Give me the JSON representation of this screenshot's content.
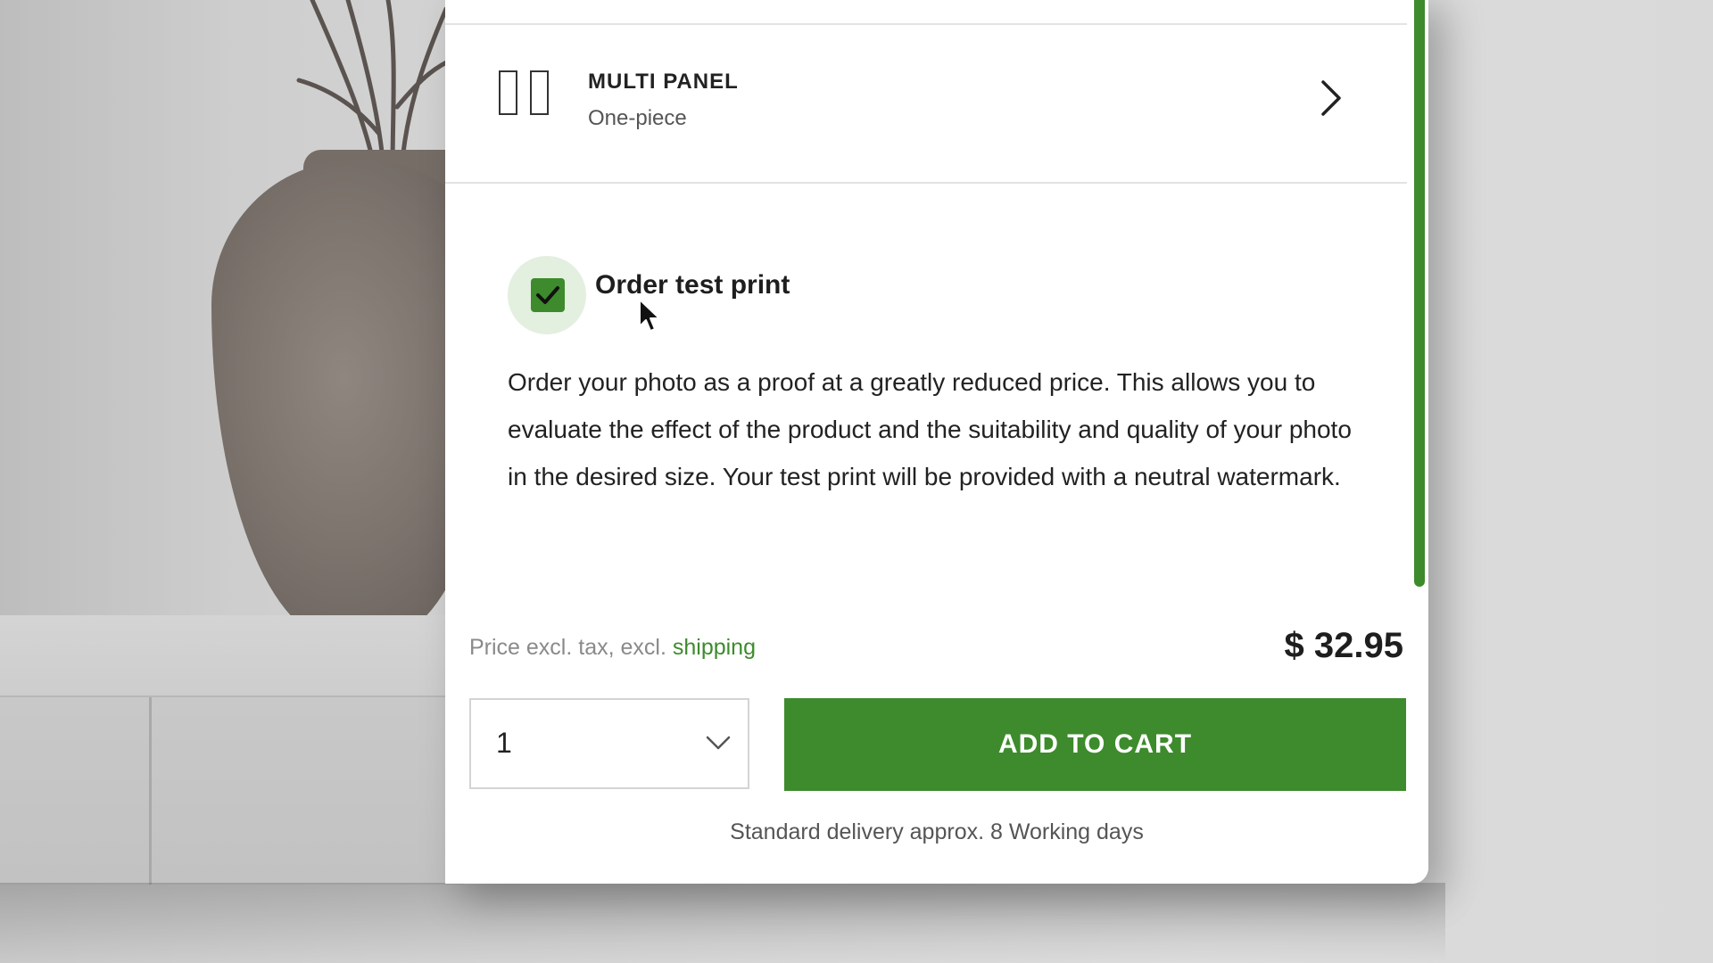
{
  "option": {
    "title": "MULTI PANEL",
    "subtitle": "One-piece",
    "icon": "multi-panel-icon"
  },
  "test_print": {
    "label": "Order test print",
    "checked": true,
    "description": "Order your photo as a proof at a greatly reduced price. This al­lows you to evaluate the effect of the product and the suitability and quality of your photo in the desired size. Your test print will be provided with a neutral watermark."
  },
  "pricing": {
    "note_prefix": "Price excl. tax, excl.",
    "note_link": "shipping",
    "price": "$ 32.95"
  },
  "quantity": {
    "value": "1"
  },
  "cart": {
    "button_label": "ADD TO CART"
  },
  "delivery": {
    "text": "Standard delivery approx. 8 Working days"
  },
  "colors": {
    "accent": "#3d8b2c",
    "halo": "#e3efdf"
  }
}
